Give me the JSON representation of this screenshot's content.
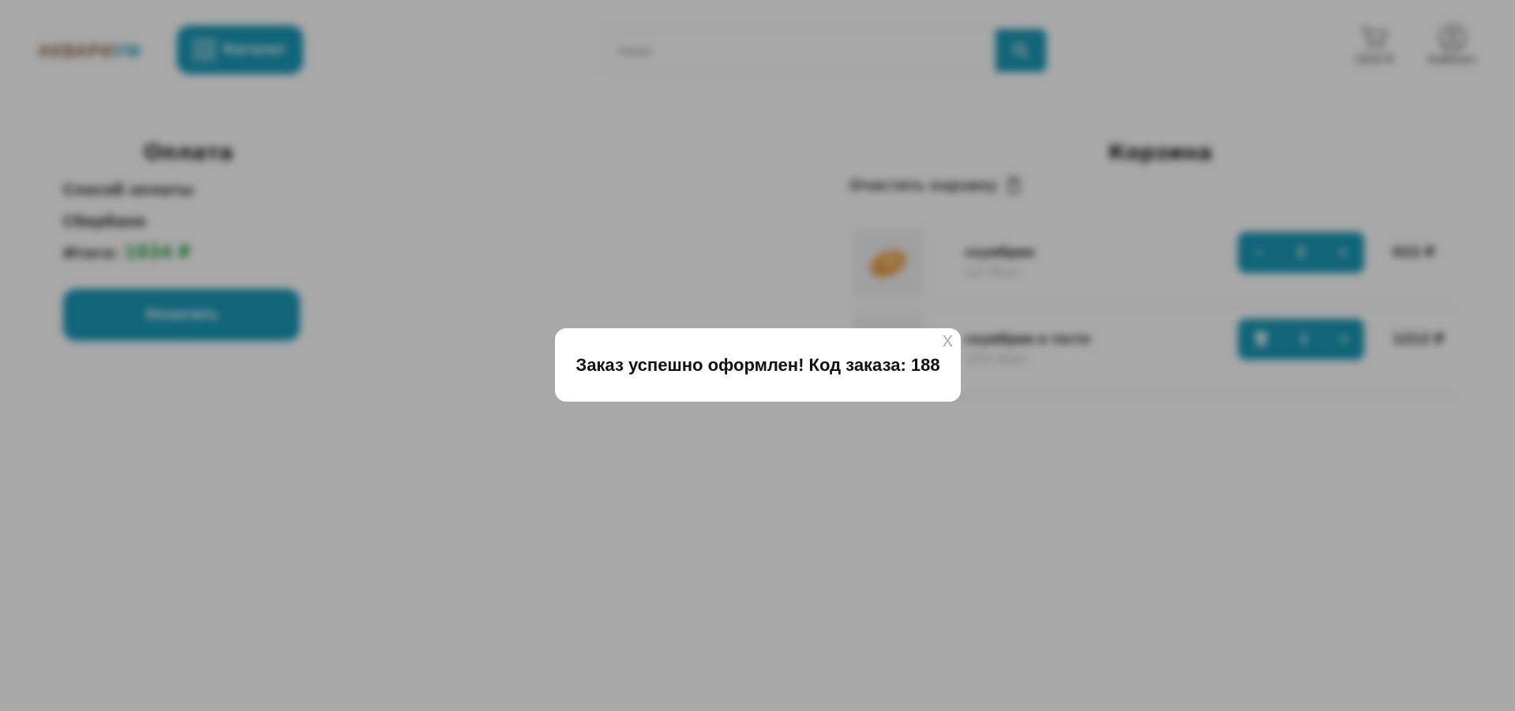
{
  "header": {
    "logo_part1": "АКВАРИ",
    "logo_part2": "УМ",
    "catalog_label": "Каталог",
    "search_placeholder": "Поиск",
    "cart_total": "1834 ₽",
    "account_label": "Кабинет"
  },
  "payment": {
    "title": "Оплата",
    "method_label": "Способ оплаты",
    "method_value": "Сбербанк",
    "total_label": "Итого:",
    "total_value": "1834 ₽",
    "pay_button": "Оплатить"
  },
  "cart": {
    "title": "Корзина",
    "clear_label": "Очистить корзину",
    "items": [
      {
        "name": "скумбрия",
        "price_per_kg": "311 ₽/шт",
        "qty": "2",
        "sum": "622 ₽"
      },
      {
        "name": "скумбрия в тесте",
        "price_per_kg": "1212 ₽/шт",
        "qty": "1",
        "sum": "1212 ₽"
      }
    ]
  },
  "modal": {
    "message": "Заказ успешно оформлен! Код заказа: 188",
    "close_label": "X"
  },
  "colors": {
    "accent": "#1999b8",
    "total_green": "#27a048",
    "overlay": "rgba(0,0,0,0.34)"
  }
}
